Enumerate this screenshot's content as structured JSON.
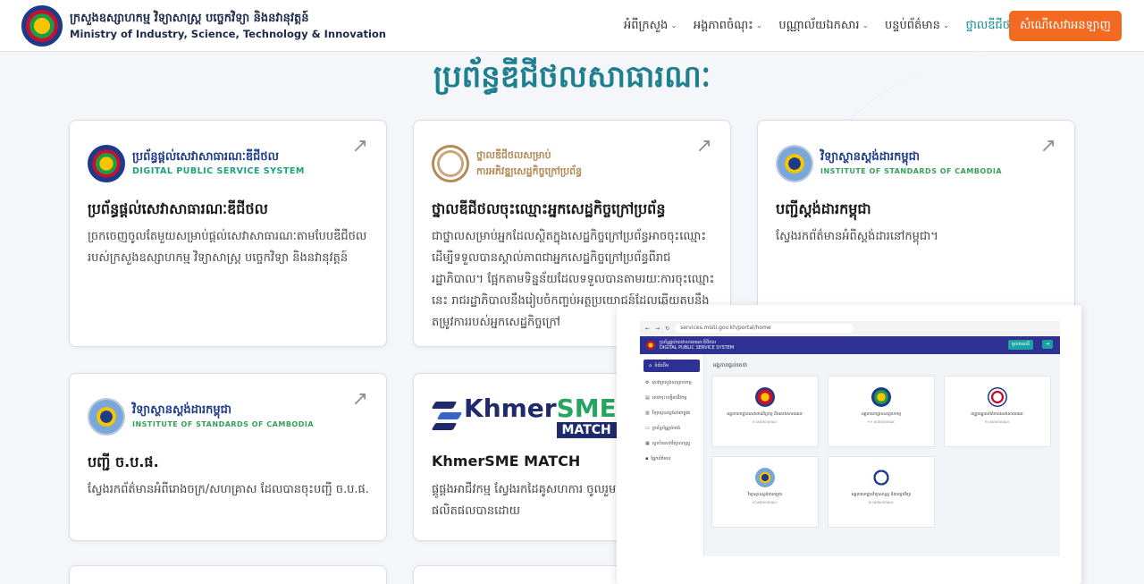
{
  "header": {
    "brand_kh": "ក្រសួងឧស្សាហកម្ម វិទ្យាសាស្ត្រ បច្ចេកវិទ្យា និងនវានុវត្តន៍",
    "brand_en": "Ministry of Industry, Science, Technology & Innovation",
    "nav": [
      "អំពីក្រសួង",
      "អង្គភាពចំណុះ",
      "បណ្ណាល័យឯកសារ",
      "បន្ទប់ព័ត៌មាន",
      "ថ្នាលឌីជីថល"
    ],
    "active_nav_index": 4,
    "login_label": "សំណើសេវាអនឡាញ"
  },
  "page_title": "ប្រព័ន្ធឌីជីថលសាធារណៈ",
  "cards": [
    {
      "logo_kh": "ប្រព័ន្ធផ្តល់សេវាសាធារណៈឌីជីថល",
      "logo_en": "DIGITAL PUBLIC SERVICE SYSTEM",
      "title": "ប្រព័ន្ធផ្តល់សេវាសាធារណៈឌីជីថល",
      "desc": "ច្រកចេញចូលតែមួយសម្រាប់ផ្តល់សេវាសាធារណៈតាមបែបឌីជីថល របស់ក្រសួងឧស្សាហកម្ម វិទ្យាសាស្ត្រ បច្ចេកវិទ្យា និងនវានុវត្តន៍"
    },
    {
      "logo_kh": "ថ្នាលឌីជីថលសម្រាប់",
      "logo_kh2": "ការអភិវឌ្ឍសេដ្ឋកិច្ចក្រៅប្រព័ន្ធ",
      "title": "ថ្នាលឌីជីថលចុះឈ្មោះអ្នកសេដ្ឋកិច្ចក្រៅប្រព័ន្ធ",
      "desc": "ជាថ្នាលសម្រាប់អ្នកដែលស្ថិតក្នុងសេដ្ឋកិច្ចក្រៅប្រព័ន្ធអាចចុះឈ្មោះ ដើម្បីទទួលបានស្គាល់ភាពជាអ្នកសេដ្ឋកិច្ចក្រៅប្រព័ន្ធពីរាជរដ្ឋាភិបាល។ ផ្អែកតាមទិន្នន័យដែលទទួលបានតាមរយៈការចុះឈ្មោះនេះ រាជរដ្ឋាភិបាលនឹងរៀបចំកញ្ចប់អត្ថប្រយោជន៍ដែលឆ្លើយតបនឹងតម្រូវការរបស់អ្នកសេដ្ឋកិច្ចក្រៅ"
    },
    {
      "logo_kh": "វិទ្យាស្ថានស្តង់ដារកម្ពុជា",
      "logo_en": "INSTITUTE OF STANDARDS OF CAMBODIA",
      "title": "បញ្ជីស្តង់ដារកម្ពុជា",
      "desc": "ស្វែងរកព័ត៌មានអំពីស្តង់ដារនៅកម្ពុជា។"
    },
    {
      "logo_kh": "វិទ្យាស្ថានស្តង់ដារកម្ពុជា",
      "logo_en": "INSTITUTE OF STANDARDS OF CAMBODIA",
      "title": "បញ្ជី ច.ប.ផ.",
      "desc": "ស្វែងរកព័ត៌មានអំពីរោងចក្រ/សហគ្រាស ដែលបានចុះបញ្ជី ច.ប.ផ."
    },
    {
      "logo_main_1": "Khmer",
      "logo_main_2": "SME",
      "logo_match": "MATCH",
      "title": "KhmerSME MATCH",
      "desc": "ផ្គូផ្គងអាជីវកម្ម ស្វែងរកដៃគូសហការ ចូលរួម បណ្តាល និងដាក់តាំងផលិតផលបានដោយ"
    }
  ],
  "overlay": {
    "url": "services.misti.gov.kh/portal/home",
    "brand": "ប្រព័ន្ធផ្តល់សេវាសាធារណៈឌីជីថល",
    "brand_en": "DIGITAL PUBLIC SERVICE SYSTEM",
    "login": "ចូលគណនី",
    "sidebar": [
      "ទំព័រដើម",
      "សេវាក្រសួងឧស្សាហកម្ម",
      "សេវាចុះបញ្ជីអាជីវកម្ម",
      "វិទ្យាស្ថានស្តង់ដារកម្ពុជា",
      "ប្រព័ន្ធប័ណ្ណប៉ាតង់",
      "ស្ថាប័នសេវាវិទ្យាសាស្ត្រ",
      "ផ្នែកព័ត៌មាន"
    ],
    "heading": "អង្គភាពផ្តល់សេវា",
    "cards": [
      {
        "label": "អគ្គនាយកដ្ឋានសេវាពាណិជ្ជកម្ម និងសេវាសាធារណៈ",
        "sub": "៥ សេវាសាធារណៈ"
      },
      {
        "label": "អគ្គនាយកដ្ឋានឧស្សាហកម្ម",
        "sub": "១១ សេវាសាធារណៈ"
      },
      {
        "label": "មជ្ឈមណ្ឌលព័ត៌មានសេវាសាធារណៈ",
        "sub": "២ សេវាសាធារណៈ"
      },
      {
        "label": "វិទ្យាស្ថានស្តង់ដារកម្ពុជា",
        "sub": "៨ សេវាសាធារណៈ"
      },
      {
        "label": "អគ្គនាយកដ្ឋានវិទ្យាសាស្ត្រ និងបច្ចេកវិទ្យា",
        "sub": "៣ សេវាសាធារណៈ"
      }
    ]
  }
}
